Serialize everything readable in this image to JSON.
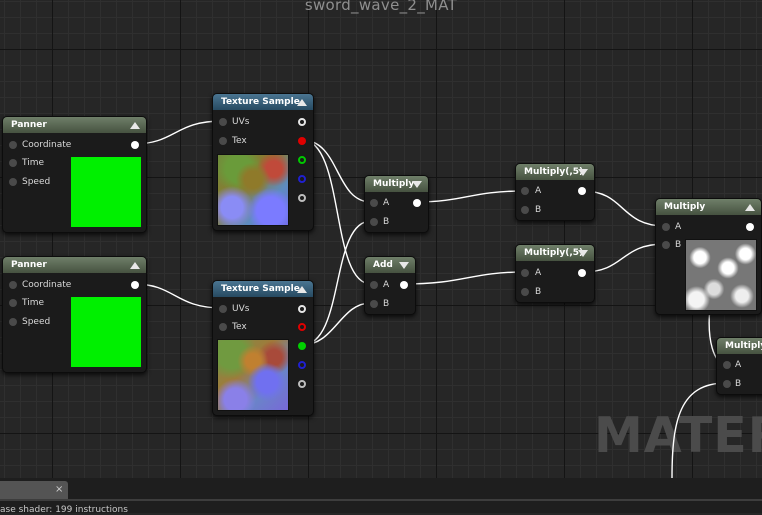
{
  "window": {
    "title": "sword_wave_2_MAT"
  },
  "watermark": "MATERIA",
  "nodes": {
    "panner1": {
      "title": "Panner",
      "pins": {
        "coordinate": "Coordinate",
        "time": "Time",
        "speed": "Speed"
      }
    },
    "panner2": {
      "title": "Panner",
      "pins": {
        "coordinate": "Coordinate",
        "time": "Time",
        "speed": "Speed"
      }
    },
    "texsample1": {
      "title": "Texture Sample",
      "pins": {
        "uvs": "UVs",
        "tex": "Tex"
      }
    },
    "texsample2": {
      "title": "Texture Sample",
      "pins": {
        "uvs": "UVs",
        "tex": "Tex"
      }
    },
    "multiply1": {
      "title": "Multiply",
      "pins": {
        "a": "A",
        "b": "B"
      }
    },
    "add1": {
      "title": "Add",
      "pins": {
        "a": "A",
        "b": "B"
      }
    },
    "multiply2": {
      "title": "Multiply(,5)",
      "pins": {
        "a": "A",
        "b": "B"
      }
    },
    "multiply3": {
      "title": "Multiply(,5)",
      "pins": {
        "a": "A",
        "b": "B"
      }
    },
    "multiply4": {
      "title": "Multiply",
      "pins": {
        "a": "A",
        "b": "B"
      }
    },
    "multiply5": {
      "title": "Multiply",
      "pins": {
        "a": "A",
        "b": "B"
      }
    }
  },
  "bottom": {
    "tab_close": "×",
    "status": "ase shader: 199 instructions"
  },
  "colors": {
    "grid_bg": "#262626",
    "header_green": "#5a6a54",
    "header_blue": "#3a627e",
    "pin_red": "#e00000",
    "pin_green": "#00d000",
    "pin_blue": "#0000c8",
    "swatch": "#00f000"
  }
}
